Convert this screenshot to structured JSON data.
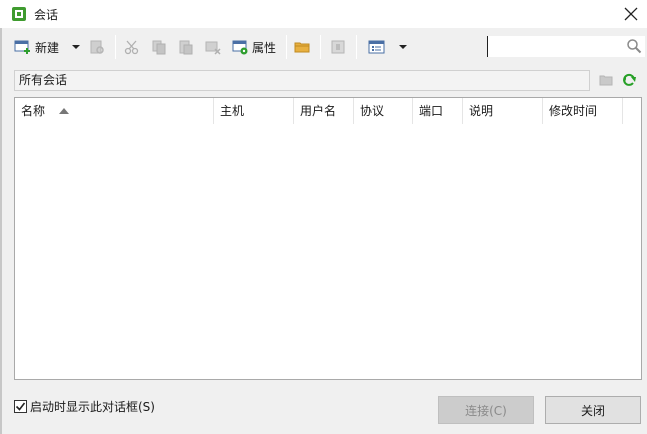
{
  "window": {
    "title": "会话"
  },
  "colors": {
    "accent_green": "#2e9e2e",
    "folder_yellow": "#e8b040",
    "refresh_green": "#27a027"
  },
  "toolbar": {
    "new_label": "新建",
    "properties_label": "属性"
  },
  "search": {
    "value": "",
    "placeholder": ""
  },
  "path": {
    "label": "所有会话"
  },
  "table": {
    "columns": [
      "名称",
      "主机",
      "用户名",
      "协议",
      "端口",
      "说明",
      "修改时间"
    ],
    "sort_column": "名称",
    "sort_direction": "ascending",
    "rows": []
  },
  "footer": {
    "show_on_startup_label": "启动时显示此对话框(S)",
    "show_on_startup_checked": true,
    "connect_label": "连接(C)",
    "close_label": "关闭"
  }
}
